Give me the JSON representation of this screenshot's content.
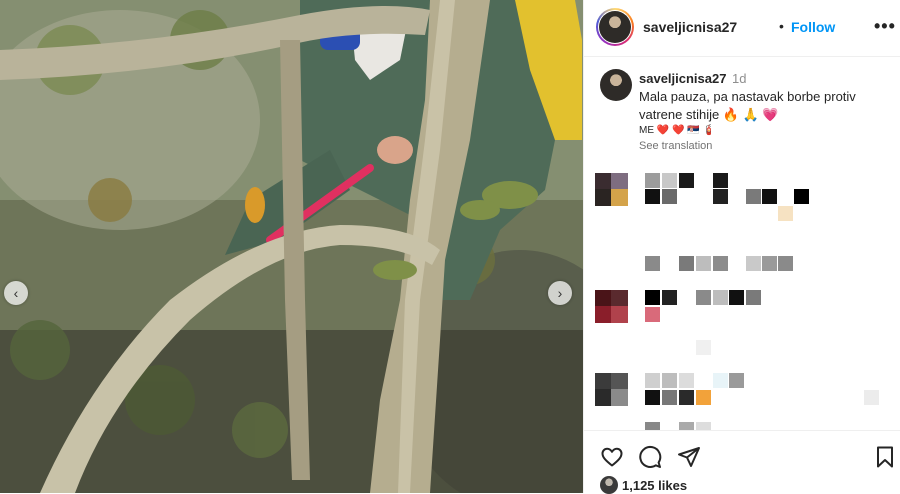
{
  "post": {
    "username": "saveljicnisa27",
    "follow_label": "Follow",
    "more_icon": "more-options-icon",
    "caption": {
      "username": "saveljicnisa27",
      "time": "1d",
      "text": "Mala pauza, pa nastavak borbe protiv vatrene stihije 🔥 🙏 💗",
      "emoji_line": "ME ❤️ ❤️ 🇷🇸 🧯",
      "see_translation": "See translation"
    },
    "comments_state": "pixelated",
    "actions": {
      "like_icon": "heart-icon",
      "comment_icon": "comment-icon",
      "share_icon": "share-icon",
      "save_icon": "bookmark-icon"
    },
    "likes_text": "1,125 likes"
  },
  "media": {
    "prev_icon": "chevron-left-icon",
    "next_icon": "chevron-right-icon",
    "prev_glyph": "‹",
    "next_glyph": "›"
  },
  "colors": {
    "follow": "#0095f6",
    "text": "#262626",
    "muted": "#8e8e8e",
    "border": "#efefef"
  }
}
